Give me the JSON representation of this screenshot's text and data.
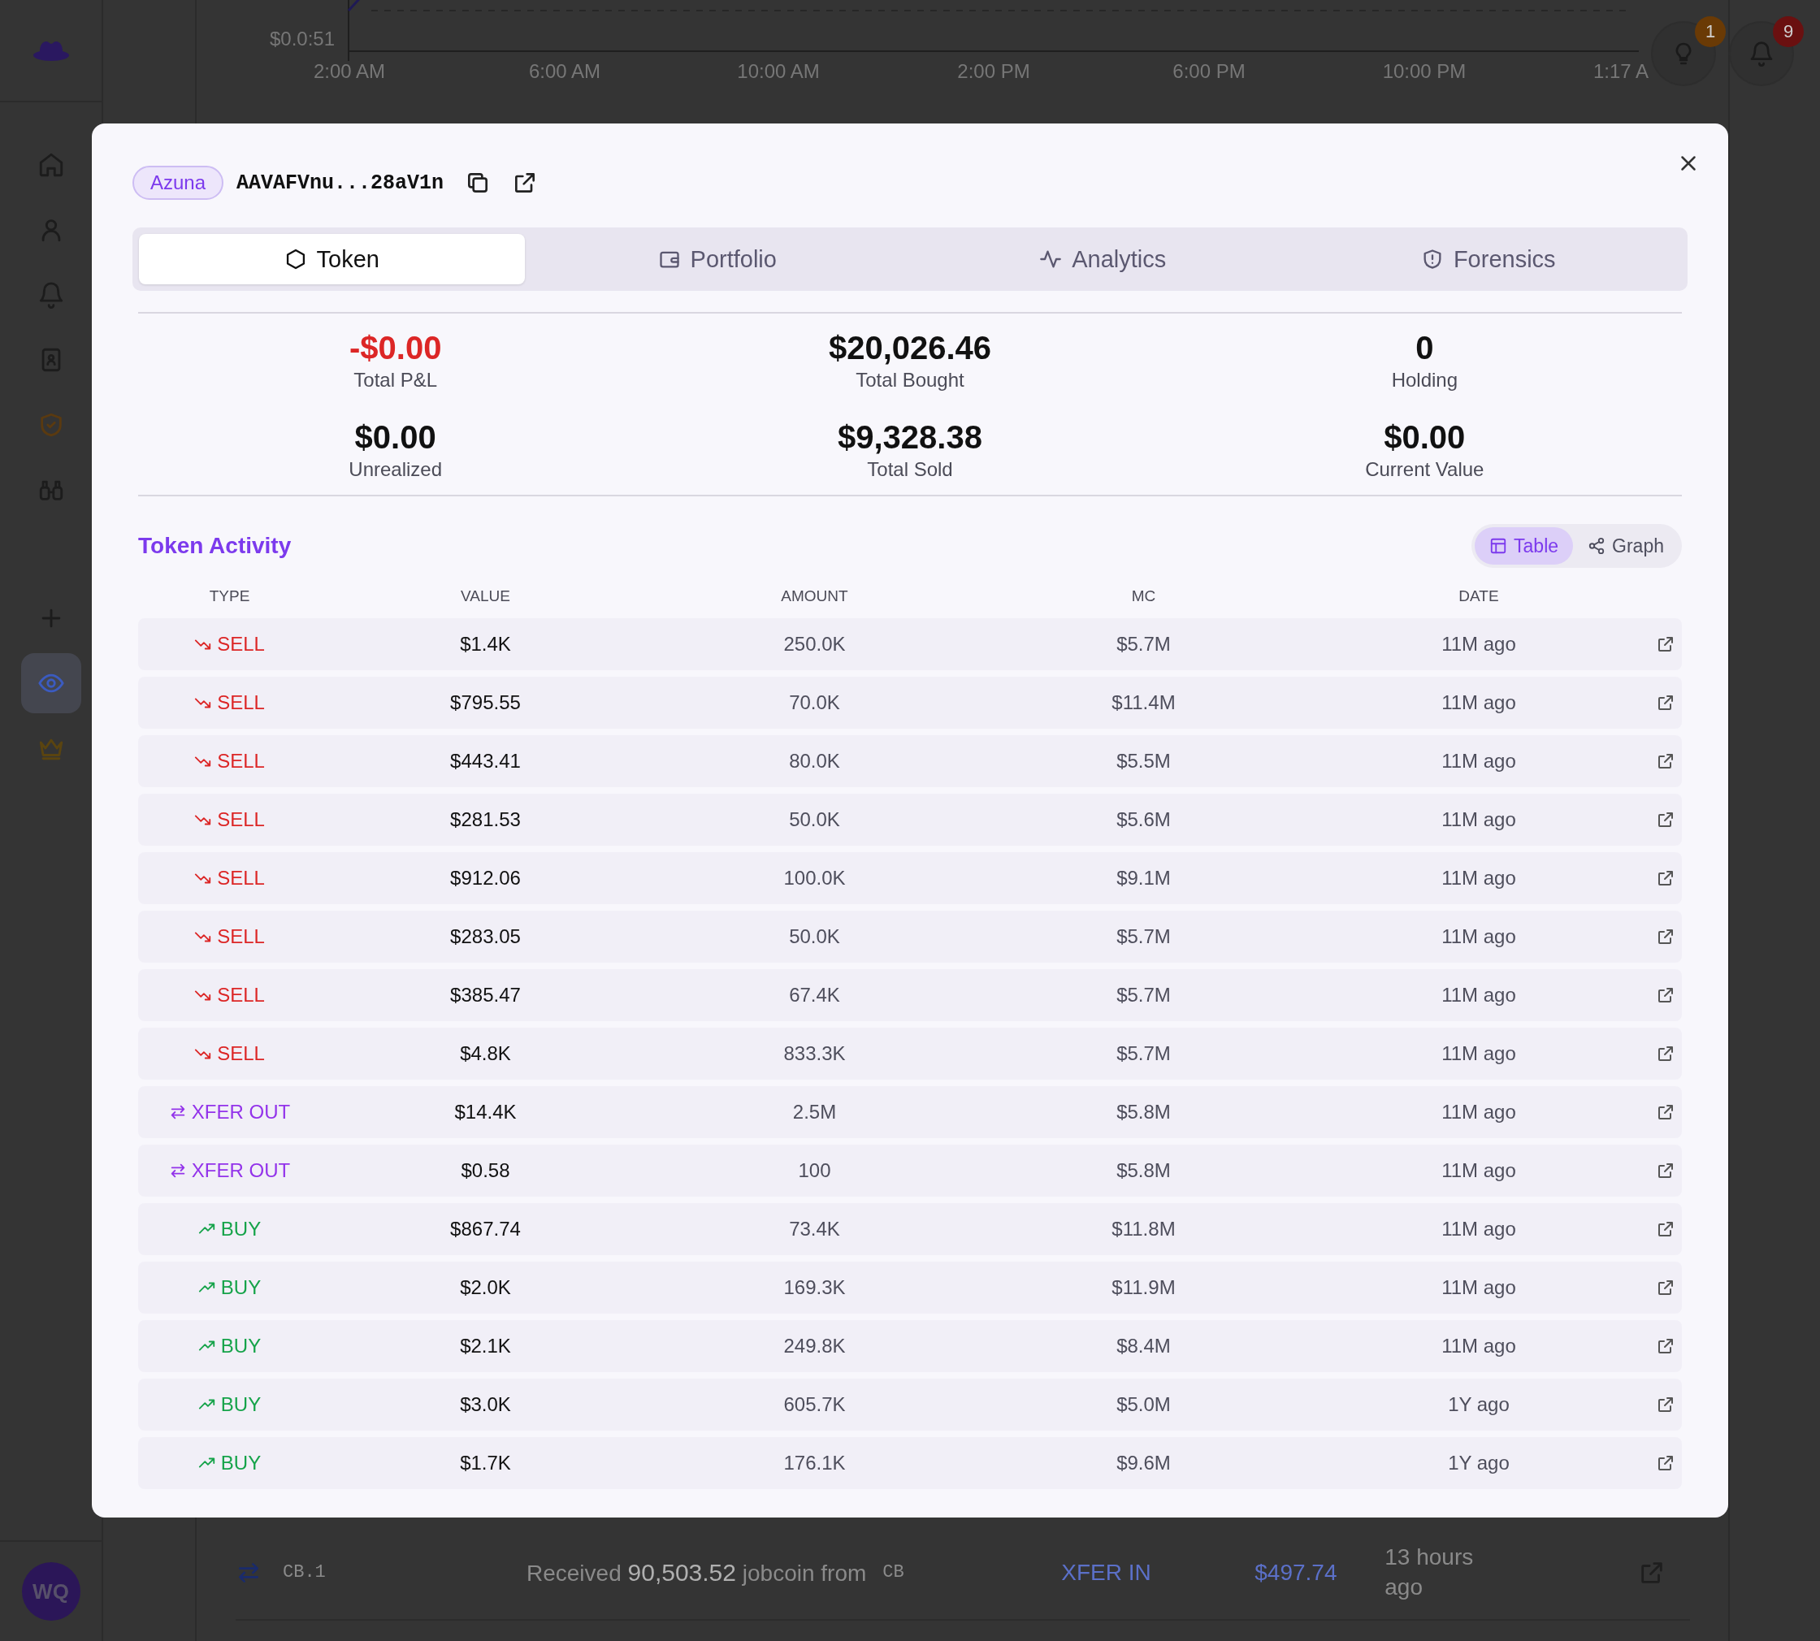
{
  "sidebar": {
    "items": [
      {
        "kind": "home",
        "selected": false
      },
      {
        "kind": "user",
        "selected": false
      },
      {
        "kind": "bell",
        "selected": false
      },
      {
        "kind": "contacts",
        "selected": false
      },
      {
        "kind": "shield",
        "selected": false
      },
      {
        "kind": "binoculars",
        "selected": false
      },
      {
        "kind": "plus",
        "selected": false
      },
      {
        "kind": "eye",
        "selected": true
      },
      {
        "kind": "crown",
        "selected": false
      }
    ],
    "avatar": {
      "initials": "WQ"
    }
  },
  "background": {
    "chart": {
      "y_label": "$0.0:51",
      "x_labels": [
        "2:00 AM",
        "6:00 AM",
        "10:00 AM",
        "2:00 PM",
        "6:00 PM",
        "10:00 PM",
        "1:17 A"
      ]
    },
    "header_buttons": [
      {
        "kind": "lightbulb",
        "count": "1"
      },
      {
        "kind": "bell",
        "count": "9"
      }
    ],
    "activity_row": {
      "wallet": "CB.1",
      "description": "Received **90,503.52** jobcoin from",
      "source": "CB",
      "type": "XFER IN",
      "value": "$497.74",
      "time": "13 hours ago"
    }
  },
  "modal": {
    "wallet": {
      "label": "Azuna",
      "address": "AAVAFVnu...28aV1n"
    },
    "tabs": [
      {
        "kind": "token",
        "label": "Token",
        "selected": true
      },
      {
        "kind": "portfolio",
        "label": "Portfolio",
        "selected": false
      },
      {
        "kind": "analytics",
        "label": "Analytics",
        "selected": false
      },
      {
        "kind": "forensics",
        "label": "Forensics",
        "selected": false
      }
    ],
    "stats": [
      {
        "value": "-$0.00",
        "label": "Total P&L",
        "kind": "loss"
      },
      {
        "value": "$20,026.46",
        "label": "Total Bought",
        "kind": "neutral"
      },
      {
        "value": "0",
        "label": "Holding",
        "kind": "neutral"
      },
      {
        "value": "$0.00",
        "label": "Unrealized",
        "kind": "neutral"
      },
      {
        "value": "$9,328.38",
        "label": "Total Sold",
        "kind": "neutral"
      },
      {
        "value": "$0.00",
        "label": "Current Value",
        "kind": "neutral"
      }
    ],
    "activity": {
      "title": "Token Activity",
      "views": [
        {
          "kind": "table",
          "label": "Table",
          "selected": true
        },
        {
          "kind": "graph",
          "label": "Graph",
          "selected": false
        }
      ],
      "columns": [
        "TYPE",
        "VALUE",
        "AMOUNT",
        "MC",
        "DATE"
      ],
      "rows": [
        {
          "kind": "sell",
          "type": "SELL",
          "value": "$1.4K",
          "amount": "250.0K",
          "mc": "$5.7M",
          "date": "11M ago"
        },
        {
          "kind": "sell",
          "type": "SELL",
          "value": "$795.55",
          "amount": "70.0K",
          "mc": "$11.4M",
          "date": "11M ago"
        },
        {
          "kind": "sell",
          "type": "SELL",
          "value": "$443.41",
          "amount": "80.0K",
          "mc": "$5.5M",
          "date": "11M ago"
        },
        {
          "kind": "sell",
          "type": "SELL",
          "value": "$281.53",
          "amount": "50.0K",
          "mc": "$5.6M",
          "date": "11M ago"
        },
        {
          "kind": "sell",
          "type": "SELL",
          "value": "$912.06",
          "amount": "100.0K",
          "mc": "$9.1M",
          "date": "11M ago"
        },
        {
          "kind": "sell",
          "type": "SELL",
          "value": "$283.05",
          "amount": "50.0K",
          "mc": "$5.7M",
          "date": "11M ago"
        },
        {
          "kind": "sell",
          "type": "SELL",
          "value": "$385.47",
          "amount": "67.4K",
          "mc": "$5.7M",
          "date": "11M ago"
        },
        {
          "kind": "sell",
          "type": "SELL",
          "value": "$4.8K",
          "amount": "833.3K",
          "mc": "$5.7M",
          "date": "11M ago"
        },
        {
          "kind": "transfer",
          "type": "XFER OUT",
          "value": "$14.4K",
          "amount": "2.5M",
          "mc": "$5.8M",
          "date": "11M ago"
        },
        {
          "kind": "transfer",
          "type": "XFER OUT",
          "value": "$0.58",
          "amount": "100",
          "mc": "$5.8M",
          "date": "11M ago"
        },
        {
          "kind": "buy",
          "type": "BUY",
          "value": "$867.74",
          "amount": "73.4K",
          "mc": "$11.8M",
          "date": "11M ago"
        },
        {
          "kind": "buy",
          "type": "BUY",
          "value": "$2.0K",
          "amount": "169.3K",
          "mc": "$11.9M",
          "date": "11M ago"
        },
        {
          "kind": "buy",
          "type": "BUY",
          "value": "$2.1K",
          "amount": "249.8K",
          "mc": "$8.4M",
          "date": "11M ago"
        },
        {
          "kind": "buy",
          "type": "BUY",
          "value": "$3.0K",
          "amount": "605.7K",
          "mc": "$5.0M",
          "date": "1Y ago"
        },
        {
          "kind": "buy",
          "type": "BUY",
          "value": "$1.7K",
          "amount": "176.1K",
          "mc": "$9.6M",
          "date": "1Y ago"
        }
      ]
    }
  }
}
